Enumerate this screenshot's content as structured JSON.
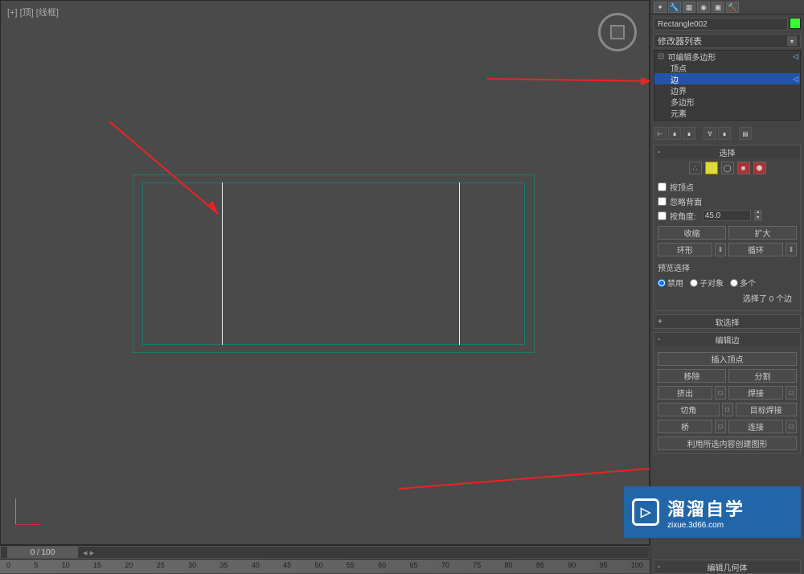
{
  "viewport": {
    "label": "[+] [顶] [线框]"
  },
  "timeline": {
    "position": "0 / 100",
    "ticks": [
      "0",
      "5",
      "10",
      "15",
      "20",
      "25",
      "30",
      "35",
      "40",
      "45",
      "50",
      "55",
      "60",
      "65",
      "70",
      "75",
      "80",
      "85",
      "90",
      "95",
      "100"
    ]
  },
  "panel": {
    "objectName": "Rectangle002",
    "modifierListLabel": "修改器列表",
    "stack": {
      "root": "可编辑多边形",
      "items": [
        "顶点",
        "边",
        "边界",
        "多边形",
        "元素"
      ],
      "selectedIndex": 1
    }
  },
  "rollouts": {
    "selection": {
      "title": "选择",
      "byVertex": "按顶点",
      "ignoreBackface": "忽略背面",
      "byAngle": "按角度:",
      "angleValue": "45.0",
      "shrink": "收缩",
      "grow": "扩大",
      "ring": "环形",
      "loop": "循环",
      "previewLabel": "预览选择",
      "disable": "禁用",
      "subobj": "子对象",
      "multi": "多个",
      "statusText": "选择了 0 个边"
    },
    "softSelection": {
      "title": "软选择"
    },
    "editEdges": {
      "title": "编辑边",
      "insertVertex": "插入顶点",
      "remove": "移除",
      "split": "分割",
      "extrude": "挤出",
      "weld": "焊接",
      "chamfer": "切角",
      "targetWeld": "目标焊接",
      "bridge": "桥",
      "connect": "连接",
      "createShape": "利用所选内容创建图形"
    },
    "editGeometry": {
      "title": "编辑几何体"
    }
  },
  "watermark": {
    "title": "溜溜自学",
    "url": "zixue.3d66.com"
  }
}
